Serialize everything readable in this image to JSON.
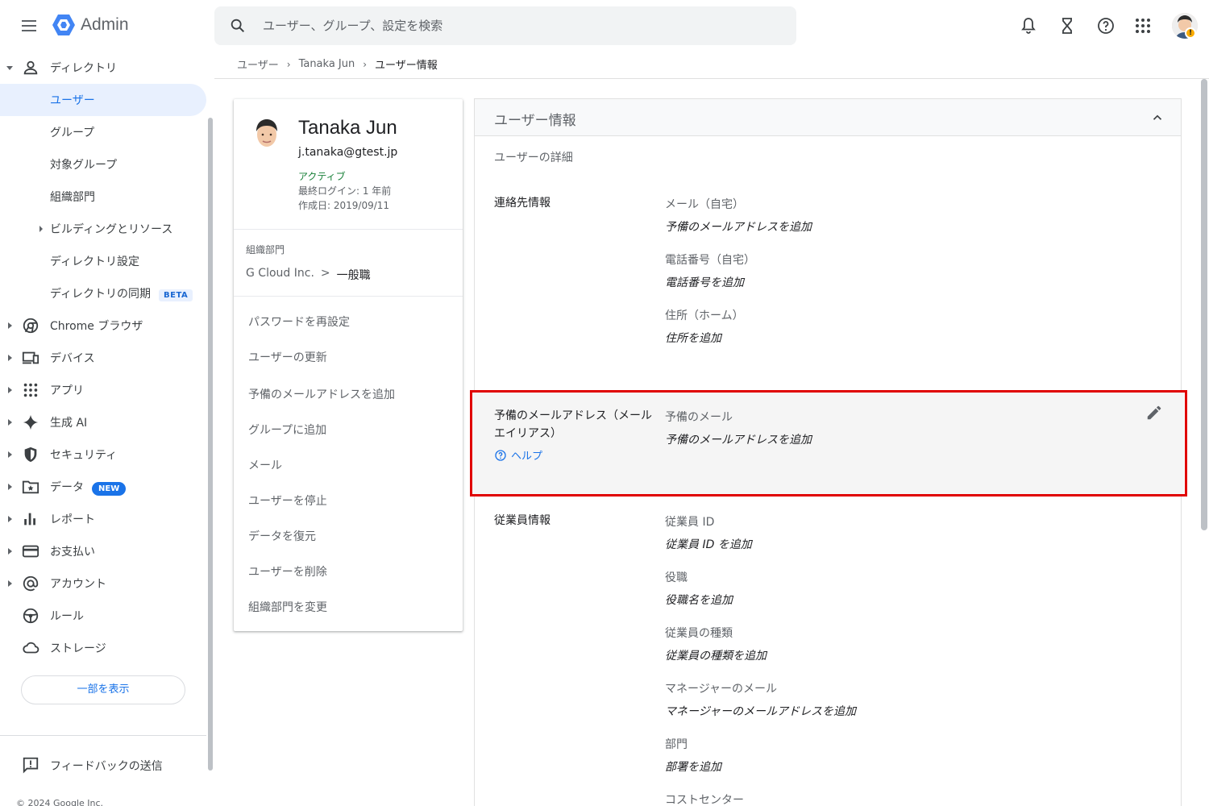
{
  "app": {
    "name": "Admin"
  },
  "search": {
    "placeholder": "ユーザー、グループ、設定を検索"
  },
  "sidebar": {
    "items": [
      {
        "label": "ディレクトリ"
      },
      {
        "label": "ユーザー"
      },
      {
        "label": "グループ"
      },
      {
        "label": "対象グループ"
      },
      {
        "label": "組織部門"
      },
      {
        "label": "ビルディングとリソース"
      },
      {
        "label": "ディレクトリ設定"
      },
      {
        "label": "ディレクトリの同期",
        "badge": "BETA"
      },
      {
        "label": "Chrome ブラウザ"
      },
      {
        "label": "デバイス"
      },
      {
        "label": "アプリ"
      },
      {
        "label": "生成 AI"
      },
      {
        "label": "セキュリティ"
      },
      {
        "label": "データ",
        "badge": "NEW"
      },
      {
        "label": "レポート"
      },
      {
        "label": "お支払い"
      },
      {
        "label": "アカウント"
      },
      {
        "label": "ルール"
      },
      {
        "label": "ストレージ"
      }
    ],
    "show_less": "一部を表示",
    "feedback": "フィードバックの送信",
    "copyright": "© 2024 Google Inc."
  },
  "breadcrumb": {
    "items": [
      "ユーザー",
      "Tanaka Jun",
      "ユーザー情報"
    ]
  },
  "profile": {
    "name": "Tanaka Jun",
    "email": "j.tanaka@gtest.jp",
    "status": "アクティブ",
    "last_login": "最終ログイン: 1 年前",
    "created": "作成日: 2019/09/11",
    "org_label": "組織部門",
    "org_parent": "G Cloud Inc.",
    "org_sep": ">",
    "org_leaf": "一般職",
    "actions": [
      "パスワードを再設定",
      "ユーザーの更新",
      "予備のメールアドレスを追加",
      "グループに追加",
      "メール",
      "ユーザーを停止",
      "データを復元",
      "ユーザーを削除",
      "組織部門を変更"
    ]
  },
  "user_info": {
    "title": "ユーザー情報",
    "subtitle": "ユーザーの詳細",
    "contact": {
      "label": "連絡先情報",
      "fields": [
        {
          "label": "メール（自宅）",
          "value": "予備のメールアドレスを追加"
        },
        {
          "label": "電話番号（自宅）",
          "value": "電話番号を追加"
        },
        {
          "label": "住所（ホーム）",
          "value": "住所を追加"
        }
      ]
    },
    "alias": {
      "label": "予備のメールアドレス（メール エイリアス）",
      "help": "ヘルプ",
      "field_label": "予備のメール",
      "field_value": "予備のメールアドレスを追加"
    },
    "employee": {
      "label": "従業員情報",
      "fields": [
        {
          "label": "従業員 ID",
          "value": "従業員 ID を追加"
        },
        {
          "label": "役職",
          "value": "役職名を追加"
        },
        {
          "label": "従業員の種類",
          "value": "従業員の種類を追加"
        },
        {
          "label": "マネージャーのメール",
          "value": "マネージャーのメールアドレスを追加"
        },
        {
          "label": "部門",
          "value": "部署を追加"
        },
        {
          "label": "コストセンター",
          "value": ""
        }
      ]
    }
  },
  "colors": {
    "accent": "#1a73e8",
    "active_bg": "#e8f0fe",
    "status_green": "#188038",
    "highlight": "#e00000"
  }
}
